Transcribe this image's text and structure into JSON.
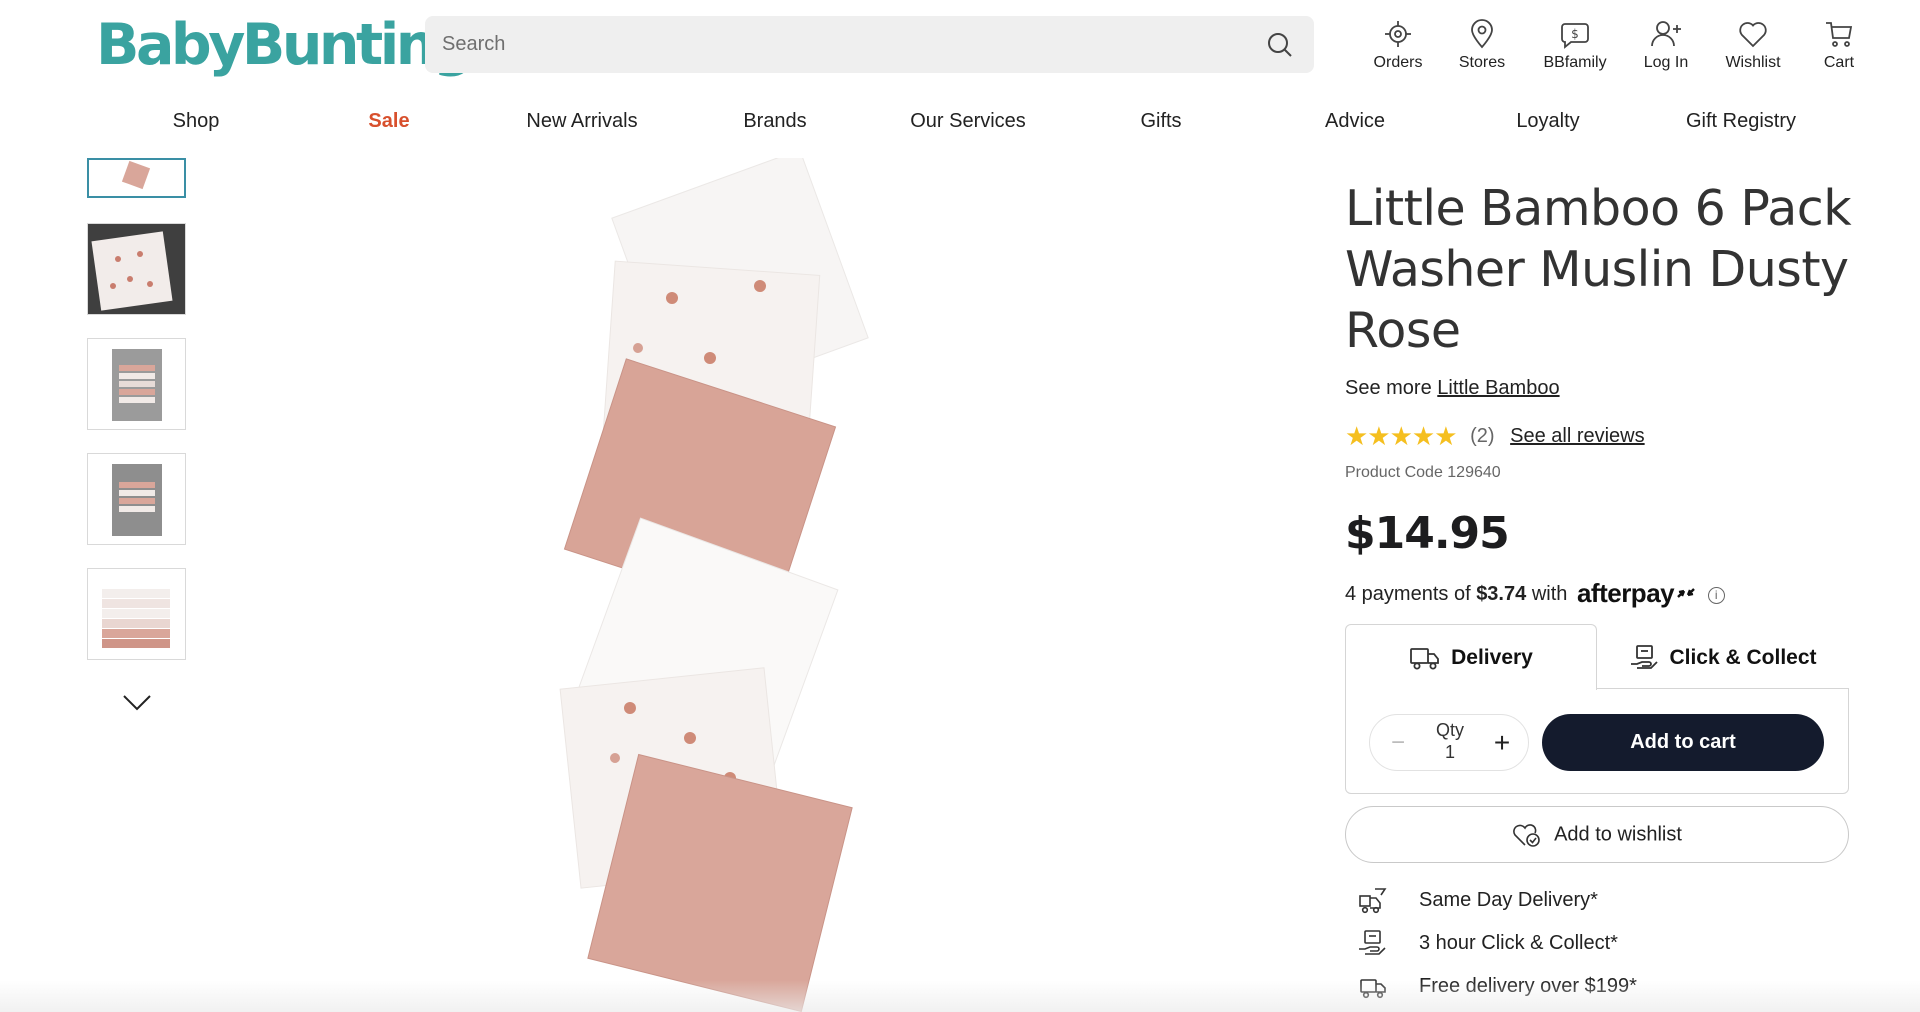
{
  "brand": {
    "logo_text": "BabyBunting",
    "logo_color": "#3aa3a0"
  },
  "search": {
    "placeholder": "Search"
  },
  "header_icons": [
    {
      "label": "Orders",
      "icon": "orders-icon"
    },
    {
      "label": "Stores",
      "icon": "location-pin-icon"
    },
    {
      "label": "BBfamily",
      "icon": "bbfamily-icon"
    },
    {
      "label": "Log In",
      "icon": "user-plus-icon"
    },
    {
      "label": "Wishlist",
      "icon": "heart-icon"
    },
    {
      "label": "Cart",
      "icon": "cart-icon"
    }
  ],
  "nav": {
    "items": [
      "Shop",
      "Sale",
      "New Arrivals",
      "Brands",
      "Our Services",
      "Gifts",
      "Advice",
      "Loyalty",
      "Gift Registry"
    ],
    "sale_color": "#d8502d"
  },
  "product": {
    "title": "Little Bamboo 6 Pack Washer Muslin Dusty Rose",
    "see_more_prefix": "See more",
    "brand_link": "Little Bamboo",
    "rating": {
      "stars": 5,
      "count_text": "(2)",
      "reviews_link": "See all reviews"
    },
    "code_text": "Product Code 129640",
    "price": "$14.95",
    "afterpay": {
      "prefix": "4 payments of",
      "amount": "$3.74",
      "with": "with",
      "logo": "afterpay",
      "info": "i"
    }
  },
  "fulfilment": {
    "tabs": [
      {
        "label": "Delivery",
        "icon": "delivery-truck-icon",
        "active": true
      },
      {
        "label": "Click & Collect",
        "icon": "click-collect-icon",
        "active": false
      }
    ],
    "qty_label": "Qty",
    "qty_value": "1",
    "add_to_cart": "Add to cart",
    "add_to_wishlist": "Add to wishlist"
  },
  "features": [
    {
      "label": "Same Day Delivery*",
      "icon": "same-day-delivery-icon"
    },
    {
      "label": "3 hour Click & Collect*",
      "icon": "click-collect-icon"
    },
    {
      "label": "Free delivery over $199*",
      "icon": "free-delivery-truck-icon"
    }
  ],
  "colors": {
    "primary_button": "#141b2d",
    "star": "#f5bf1f",
    "active_thumb_border": "#3a8fa5",
    "muslin_rose": "#d9a69a"
  }
}
